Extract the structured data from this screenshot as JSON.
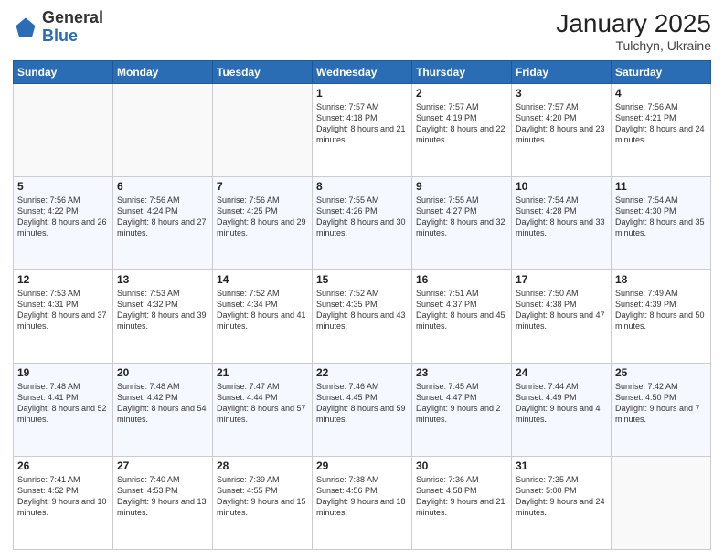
{
  "logo": {
    "general": "General",
    "blue": "Blue"
  },
  "header": {
    "month_year": "January 2025",
    "location": "Tulchyn, Ukraine"
  },
  "days_of_week": [
    "Sunday",
    "Monday",
    "Tuesday",
    "Wednesday",
    "Thursday",
    "Friday",
    "Saturday"
  ],
  "weeks": [
    [
      {
        "day": "",
        "content": ""
      },
      {
        "day": "",
        "content": ""
      },
      {
        "day": "",
        "content": ""
      },
      {
        "day": "1",
        "content": "Sunrise: 7:57 AM\nSunset: 4:18 PM\nDaylight: 8 hours\nand 21 minutes."
      },
      {
        "day": "2",
        "content": "Sunrise: 7:57 AM\nSunset: 4:19 PM\nDaylight: 8 hours\nand 22 minutes."
      },
      {
        "day": "3",
        "content": "Sunrise: 7:57 AM\nSunset: 4:20 PM\nDaylight: 8 hours\nand 23 minutes."
      },
      {
        "day": "4",
        "content": "Sunrise: 7:56 AM\nSunset: 4:21 PM\nDaylight: 8 hours\nand 24 minutes."
      }
    ],
    [
      {
        "day": "5",
        "content": "Sunrise: 7:56 AM\nSunset: 4:22 PM\nDaylight: 8 hours\nand 26 minutes."
      },
      {
        "day": "6",
        "content": "Sunrise: 7:56 AM\nSunset: 4:24 PM\nDaylight: 8 hours\nand 27 minutes."
      },
      {
        "day": "7",
        "content": "Sunrise: 7:56 AM\nSunset: 4:25 PM\nDaylight: 8 hours\nand 29 minutes."
      },
      {
        "day": "8",
        "content": "Sunrise: 7:55 AM\nSunset: 4:26 PM\nDaylight: 8 hours\nand 30 minutes."
      },
      {
        "day": "9",
        "content": "Sunrise: 7:55 AM\nSunset: 4:27 PM\nDaylight: 8 hours\nand 32 minutes."
      },
      {
        "day": "10",
        "content": "Sunrise: 7:54 AM\nSunset: 4:28 PM\nDaylight: 8 hours\nand 33 minutes."
      },
      {
        "day": "11",
        "content": "Sunrise: 7:54 AM\nSunset: 4:30 PM\nDaylight: 8 hours\nand 35 minutes."
      }
    ],
    [
      {
        "day": "12",
        "content": "Sunrise: 7:53 AM\nSunset: 4:31 PM\nDaylight: 8 hours\nand 37 minutes."
      },
      {
        "day": "13",
        "content": "Sunrise: 7:53 AM\nSunset: 4:32 PM\nDaylight: 8 hours\nand 39 minutes."
      },
      {
        "day": "14",
        "content": "Sunrise: 7:52 AM\nSunset: 4:34 PM\nDaylight: 8 hours\nand 41 minutes."
      },
      {
        "day": "15",
        "content": "Sunrise: 7:52 AM\nSunset: 4:35 PM\nDaylight: 8 hours\nand 43 minutes."
      },
      {
        "day": "16",
        "content": "Sunrise: 7:51 AM\nSunset: 4:37 PM\nDaylight: 8 hours\nand 45 minutes."
      },
      {
        "day": "17",
        "content": "Sunrise: 7:50 AM\nSunset: 4:38 PM\nDaylight: 8 hours\nand 47 minutes."
      },
      {
        "day": "18",
        "content": "Sunrise: 7:49 AM\nSunset: 4:39 PM\nDaylight: 8 hours\nand 50 minutes."
      }
    ],
    [
      {
        "day": "19",
        "content": "Sunrise: 7:48 AM\nSunset: 4:41 PM\nDaylight: 8 hours\nand 52 minutes."
      },
      {
        "day": "20",
        "content": "Sunrise: 7:48 AM\nSunset: 4:42 PM\nDaylight: 8 hours\nand 54 minutes."
      },
      {
        "day": "21",
        "content": "Sunrise: 7:47 AM\nSunset: 4:44 PM\nDaylight: 8 hours\nand 57 minutes."
      },
      {
        "day": "22",
        "content": "Sunrise: 7:46 AM\nSunset: 4:45 PM\nDaylight: 8 hours\nand 59 minutes."
      },
      {
        "day": "23",
        "content": "Sunrise: 7:45 AM\nSunset: 4:47 PM\nDaylight: 9 hours\nand 2 minutes."
      },
      {
        "day": "24",
        "content": "Sunrise: 7:44 AM\nSunset: 4:49 PM\nDaylight: 9 hours\nand 4 minutes."
      },
      {
        "day": "25",
        "content": "Sunrise: 7:42 AM\nSunset: 4:50 PM\nDaylight: 9 hours\nand 7 minutes."
      }
    ],
    [
      {
        "day": "26",
        "content": "Sunrise: 7:41 AM\nSunset: 4:52 PM\nDaylight: 9 hours\nand 10 minutes."
      },
      {
        "day": "27",
        "content": "Sunrise: 7:40 AM\nSunset: 4:53 PM\nDaylight: 9 hours\nand 13 minutes."
      },
      {
        "day": "28",
        "content": "Sunrise: 7:39 AM\nSunset: 4:55 PM\nDaylight: 9 hours\nand 15 minutes."
      },
      {
        "day": "29",
        "content": "Sunrise: 7:38 AM\nSunset: 4:56 PM\nDaylight: 9 hours\nand 18 minutes."
      },
      {
        "day": "30",
        "content": "Sunrise: 7:36 AM\nSunset: 4:58 PM\nDaylight: 9 hours\nand 21 minutes."
      },
      {
        "day": "31",
        "content": "Sunrise: 7:35 AM\nSunset: 5:00 PM\nDaylight: 9 hours\nand 24 minutes."
      },
      {
        "day": "",
        "content": ""
      }
    ]
  ]
}
